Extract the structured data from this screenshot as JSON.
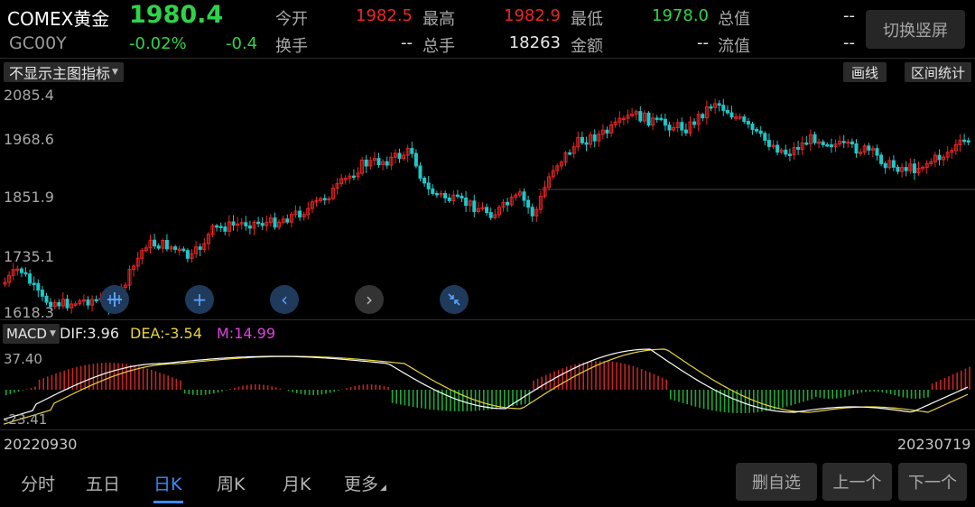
{
  "header": {
    "symbol_name": "COMEX黄金",
    "last_price": "1980.4",
    "symbol_code": "GC00Y",
    "change_pct": "-0.02%",
    "change": "-0.4",
    "stats": [
      {
        "label": "今开",
        "value": "1982.5",
        "tone": "red"
      },
      {
        "label": "最高",
        "value": "1982.9",
        "tone": "red"
      },
      {
        "label": "最低",
        "value": "1978.0",
        "tone": "green"
      },
      {
        "label": "总值",
        "value": "--",
        "tone": "white"
      },
      {
        "label": "换手",
        "value": "--",
        "tone": "white"
      },
      {
        "label": "总手",
        "value": "18263",
        "tone": "white"
      },
      {
        "label": "金额",
        "value": "--",
        "tone": "white"
      },
      {
        "label": "流值",
        "value": "--",
        "tone": "white"
      }
    ],
    "switch_button": "切换竖屏"
  },
  "toolbar": {
    "indicator_select": "不显示主图指标",
    "draw_button": "画线",
    "range_stats_button": "区间统计"
  },
  "main_chart": {
    "y_ticks": [
      "2085.4",
      "1968.6",
      "1851.9",
      "1735.1",
      "1618.3"
    ]
  },
  "nav_buttons": [
    {
      "name": "crosshair-button",
      "icon": "crosshair-icon"
    },
    {
      "name": "zoom-in-button",
      "icon": "plus-icon"
    },
    {
      "name": "scroll-left-button",
      "icon": "chevron-left-icon"
    },
    {
      "name": "scroll-right-button",
      "icon": "chevron-right-icon"
    },
    {
      "name": "collapse-button",
      "icon": "shrink-arrows-icon"
    }
  ],
  "macd": {
    "select": "MACD",
    "dif_text": "DIF:3.96",
    "dea_text": "DEA:-3.54",
    "m_text": "M:14.99",
    "y_top": "37.40",
    "y_bottom": "-23.41"
  },
  "dates": {
    "start": "20220930",
    "end": "20230719"
  },
  "tabs": [
    "分时",
    "五日",
    "日K",
    "周K",
    "月K",
    "更多"
  ],
  "active_tab": "日K",
  "buttons": {
    "remove_watch": "删自选",
    "prev": "上一个",
    "next": "下一个"
  },
  "colors": {
    "up": "#ec2525",
    "down": "#1fc7c8",
    "accent": "#3d8bff",
    "price_green": "#2fd34a",
    "dif_line": "#ffffff",
    "dea_line": "#e9d43a",
    "m_text": "#e040e0"
  }
}
